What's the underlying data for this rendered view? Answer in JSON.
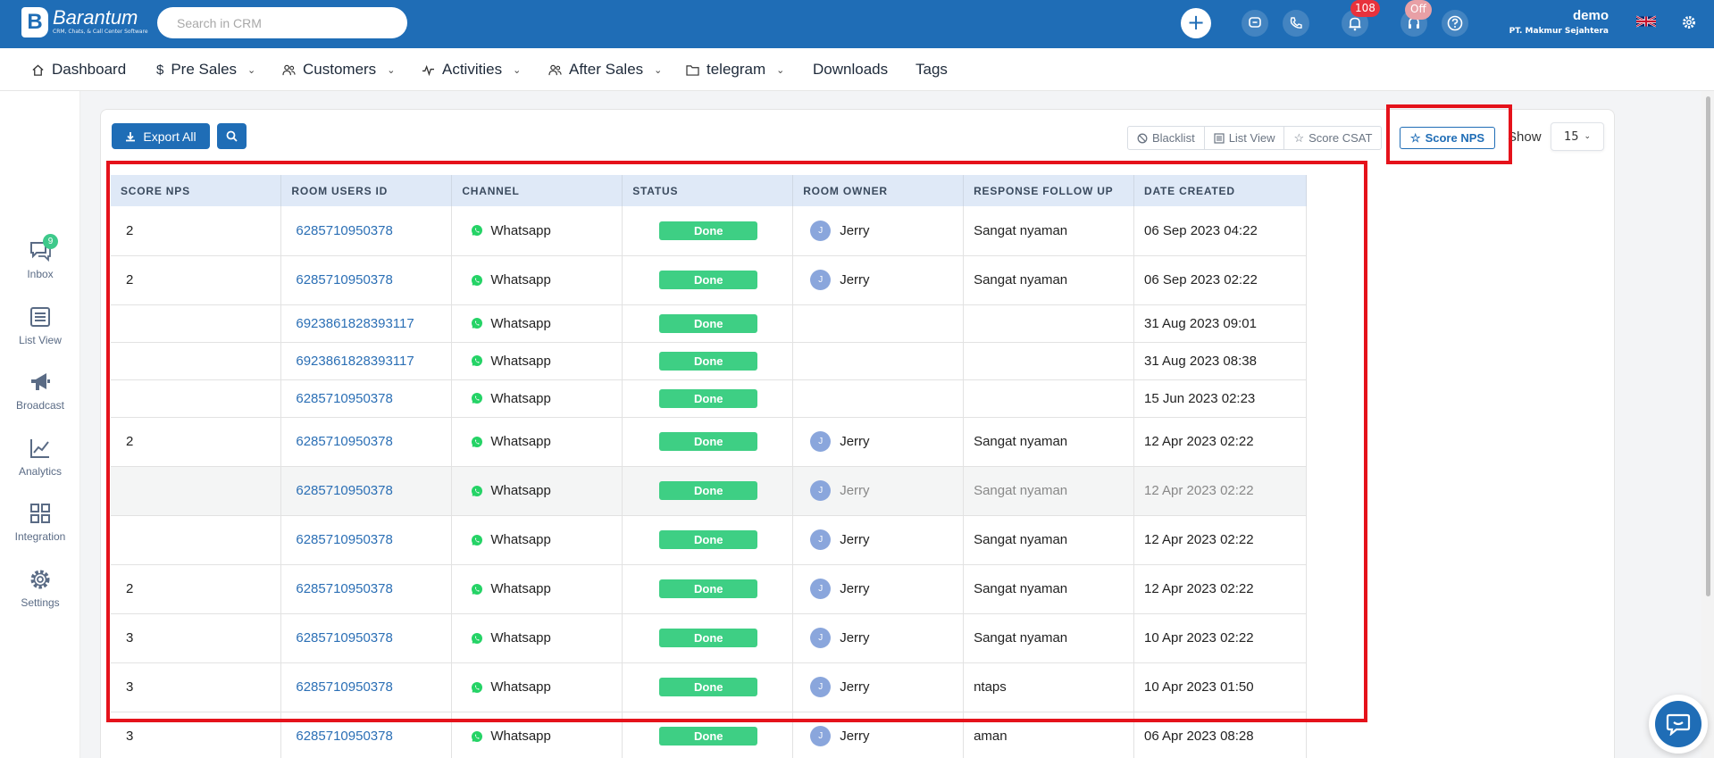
{
  "brand": {
    "name": "Barantum",
    "tagline": "CRM, Chats, & Call Center Software",
    "logo_letter": "B"
  },
  "search": {
    "placeholder": "Search in CRM"
  },
  "topbar": {
    "notification_count": "108",
    "agent_status": "Off",
    "user_name": "demo",
    "company": "PT. Makmur Sejahtera",
    "icons": [
      "plus-icon",
      "chat-icon",
      "phone-icon",
      "bell-icon",
      "headset-icon",
      "help-icon",
      "uk-flag-icon",
      "gear-icon"
    ]
  },
  "nav": {
    "items": [
      {
        "label": "Dashboard",
        "icon": "home-icon",
        "dropdown": false
      },
      {
        "label": "Pre Sales",
        "icon": "dollar-icon",
        "dropdown": true
      },
      {
        "label": "Customers",
        "icon": "users-icon",
        "dropdown": true
      },
      {
        "label": "Activities",
        "icon": "activity-icon",
        "dropdown": true
      },
      {
        "label": "After Sales",
        "icon": "users-icon",
        "dropdown": true
      },
      {
        "label": "telegram",
        "icon": "folder-icon",
        "dropdown": true
      },
      {
        "label": "Downloads",
        "icon": "",
        "dropdown": false
      },
      {
        "label": "Tags",
        "icon": "",
        "dropdown": false
      }
    ]
  },
  "sidebar": {
    "inbox_badge": "9",
    "items": [
      {
        "label": "Inbox",
        "icon": "inbox-icon"
      },
      {
        "label": "List View",
        "icon": "list-icon"
      },
      {
        "label": "Broadcast",
        "icon": "megaphone-icon"
      },
      {
        "label": "Analytics",
        "icon": "chart-icon"
      },
      {
        "label": "Integration",
        "icon": "grid-icon"
      },
      {
        "label": "Settings",
        "icon": "gear-icon"
      }
    ]
  },
  "toolbar": {
    "export_label": "Export All",
    "views": [
      "Blacklist",
      "List View",
      "Score CSAT"
    ],
    "active_view": "Score NPS",
    "show_label": "Show",
    "show_value": "15"
  },
  "table": {
    "headers": [
      "SCORE NPS",
      "ROOM USERS ID",
      "CHANNEL",
      "STATUS",
      "ROOM OWNER",
      "RESPONSE FOLLOW UP",
      "DATE CREATED"
    ],
    "rows": [
      {
        "score": "2",
        "room_id": "6285710950378",
        "channel": "Whatsapp",
        "status": "Done",
        "owner": "Jerry",
        "owner_initial": "J",
        "response": "Sangat nyaman",
        "date": "06 Sep 2023 04:22"
      },
      {
        "score": "2",
        "room_id": "6285710950378",
        "channel": "Whatsapp",
        "status": "Done",
        "owner": "Jerry",
        "owner_initial": "J",
        "response": "Sangat nyaman",
        "date": "06 Sep 2023 02:22"
      },
      {
        "score": "",
        "room_id": "6923861828393117",
        "channel": "Whatsapp",
        "status": "Done",
        "owner": "",
        "owner_initial": "",
        "response": "",
        "date": "31 Aug 2023 09:01"
      },
      {
        "score": "",
        "room_id": "6923861828393117",
        "channel": "Whatsapp",
        "status": "Done",
        "owner": "",
        "owner_initial": "",
        "response": "",
        "date": "31 Aug 2023 08:38"
      },
      {
        "score": "",
        "room_id": "6285710950378",
        "channel": "Whatsapp",
        "status": "Done",
        "owner": "",
        "owner_initial": "",
        "response": "",
        "date": "15 Jun 2023 02:23"
      },
      {
        "score": "2",
        "room_id": "6285710950378",
        "channel": "Whatsapp",
        "status": "Done",
        "owner": "Jerry",
        "owner_initial": "J",
        "response": "Sangat nyaman",
        "date": "12 Apr 2023 02:22"
      },
      {
        "score": "",
        "room_id": "6285710950378",
        "channel": "Whatsapp",
        "status": "Done",
        "owner": "Jerry",
        "owner_initial": "J",
        "response": "Sangat nyaman",
        "date": "12 Apr 2023 02:22"
      },
      {
        "score": "",
        "room_id": "6285710950378",
        "channel": "Whatsapp",
        "status": "Done",
        "owner": "Jerry",
        "owner_initial": "J",
        "response": "Sangat nyaman",
        "date": "12 Apr 2023 02:22"
      },
      {
        "score": "2",
        "room_id": "6285710950378",
        "channel": "Whatsapp",
        "status": "Done",
        "owner": "Jerry",
        "owner_initial": "J",
        "response": "Sangat nyaman",
        "date": "12 Apr 2023 02:22"
      },
      {
        "score": "3",
        "room_id": "6285710950378",
        "channel": "Whatsapp",
        "status": "Done",
        "owner": "Jerry",
        "owner_initial": "J",
        "response": "Sangat nyaman",
        "date": "10 Apr 2023 02:22"
      },
      {
        "score": "3",
        "room_id": "6285710950378",
        "channel": "Whatsapp",
        "status": "Done",
        "owner": "Jerry",
        "owner_initial": "J",
        "response": "ntaps",
        "date": "10 Apr 2023 01:50"
      },
      {
        "score": "3",
        "room_id": "6285710950378",
        "channel": "Whatsapp",
        "status": "Done",
        "owner": "Jerry",
        "owner_initial": "J",
        "response": "aman",
        "date": "06 Apr 2023 08:28"
      }
    ]
  },
  "colors": {
    "primary": "#1f6db6",
    "header_bg": "#dfe9f7",
    "done_green": "#3ecf84",
    "highlight_red": "#e5121b",
    "whatsapp_green": "#25d366"
  }
}
